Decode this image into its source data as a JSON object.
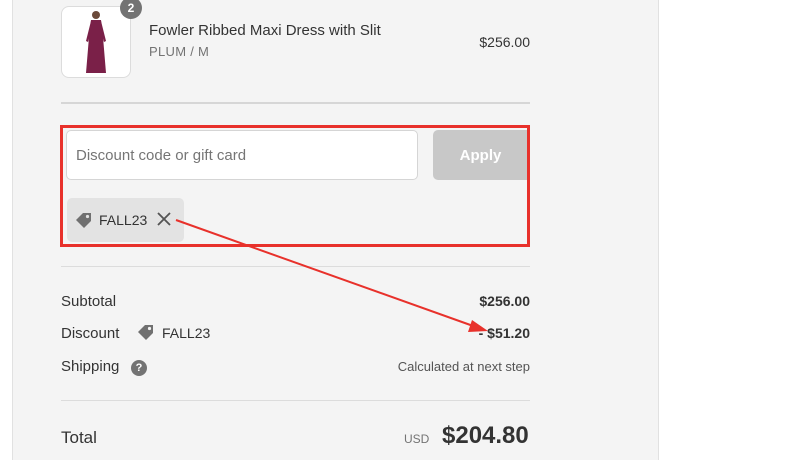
{
  "item": {
    "quantity": "2",
    "name": "Fowler Ribbed Maxi Dress with Slit",
    "variant": "PLUM / M",
    "price": "$256.00"
  },
  "discount_form": {
    "placeholder": "Discount code or gift card",
    "apply_label": "Apply",
    "applied_code": "FALL23"
  },
  "summary": {
    "subtotal_label": "Subtotal",
    "subtotal_value": "$256.00",
    "discount_label": "Discount",
    "discount_code": "FALL23",
    "discount_value": "- $51.20",
    "shipping_label": "Shipping",
    "shipping_help": "?",
    "shipping_value": "Calculated at next step",
    "total_label": "Total",
    "currency": "USD",
    "total_value": "$204.80"
  },
  "colors": {
    "annotation": "#e8312b",
    "dress": "#7a2048"
  }
}
